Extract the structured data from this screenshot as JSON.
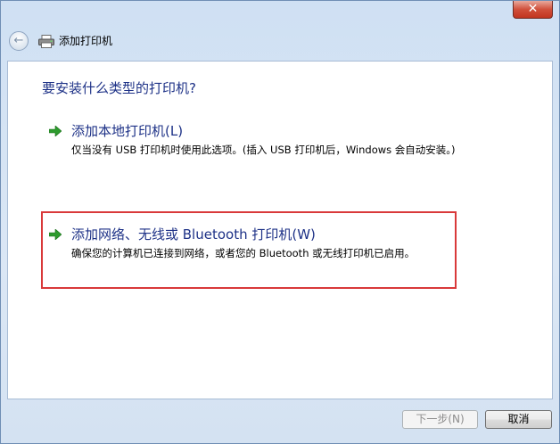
{
  "window": {
    "close_glyph": "✕",
    "colors": {
      "close_button": "#c7402b",
      "accent_text": "#1e3287",
      "highlight_box": "#d9393a"
    }
  },
  "nav": {
    "back_icon": "back-arrow-icon",
    "printer_icon": "printer-icon",
    "title": "添加打印机"
  },
  "main": {
    "heading": "要安装什么类型的打印机?",
    "options": [
      {
        "icon": "green-arrow-icon",
        "title": "添加本地打印机(L)",
        "description": "仅当没有 USB 打印机时使用此选项。(插入 USB 打印机后，Windows 会自动安装。)"
      },
      {
        "icon": "green-arrow-icon",
        "title": "添加网络、无线或 Bluetooth 打印机(W)",
        "description": "确保您的计算机已连接到网络，或者您的 Bluetooth 或无线打印机已启用。",
        "highlighted": true
      }
    ]
  },
  "footer": {
    "next_label": "下一步(N)",
    "next_enabled": false,
    "cancel_label": "取消"
  }
}
